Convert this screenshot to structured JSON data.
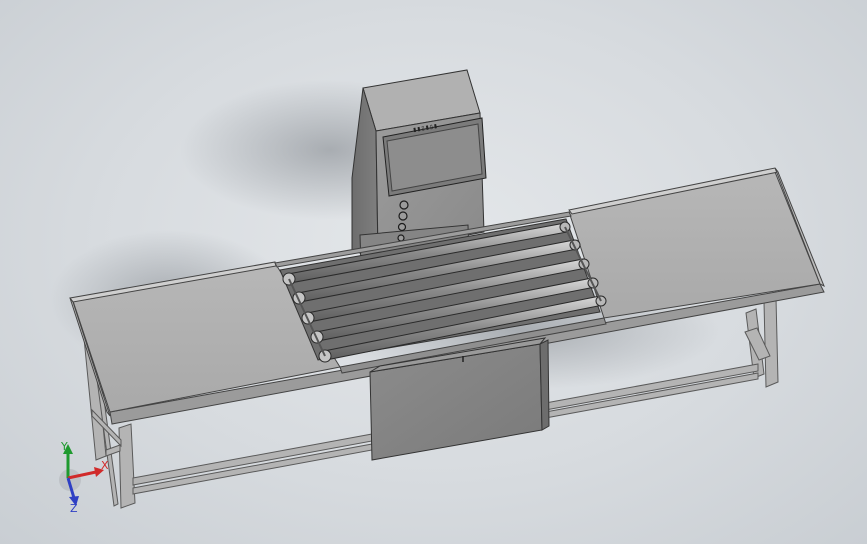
{
  "viewport": {
    "background_colors": [
      "#e4e7ea",
      "#c9ced3"
    ],
    "model_color": "#a6a6a6"
  },
  "cabinet": {
    "logo_text": "▮▮▯▮▯▮"
  },
  "triad": {
    "x_label": "X",
    "y_label": "Y",
    "z_label": "Z",
    "x_color": "#d12a2a",
    "y_color": "#1f9a2f",
    "z_color": "#2e3fc4"
  }
}
